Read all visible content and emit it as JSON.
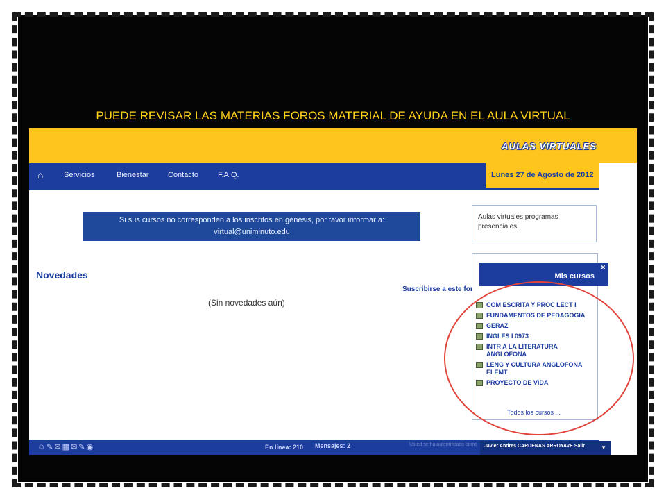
{
  "caption": "PUEDE REVISAR LAS MATERIAS FOROS MATERIAL DE AYUDA EN EL AULA VIRTUAL",
  "header": {
    "brand": "AULAS VIRTUALES"
  },
  "nav": {
    "home_icon": "home-icon",
    "items": [
      "Servicios",
      "Bienestar",
      "Contacto",
      "F.A.Q."
    ],
    "date": "Lunes 27 de Agosto de 2012"
  },
  "notice": {
    "line1": "Si sus cursos no corresponden a los inscritos en génesis, por favor informar a:",
    "line2": "virtual@uniminuto.edu"
  },
  "news": {
    "title": "Novedades",
    "subscribe": "Suscribirse a este foro",
    "empty": "(Sin novedades aún)"
  },
  "sidebar": {
    "programs_text": "Aulas virtuales programas presenciales.",
    "my_courses_title": "Mis cursos",
    "courses": [
      "COM ESCRITA Y PROC LECT I",
      "FUNDAMENTOS DE PEDAGOGIA",
      "GERAZ",
      "INGLES I 0973",
      "INTR A LA LITERATURA ANGLOFONA",
      "LENG Y CULTURA ANGLOFONA ELEMT",
      "PROYECTO DE VIDA"
    ],
    "all_courses": "Todos los cursos ..."
  },
  "footer": {
    "online": "En línea: 210",
    "messages": "Mensajes: 2",
    "faded_text": "Usted se ha autentificado como",
    "user": "Javier Andres CARDENAS ARROYAVE  Salir"
  },
  "colors": {
    "frame": "#050505",
    "caption": "#ffd21a",
    "yellow": "#fdc51d",
    "blue": "#1c3c9e",
    "highlight": "#e0443b"
  }
}
